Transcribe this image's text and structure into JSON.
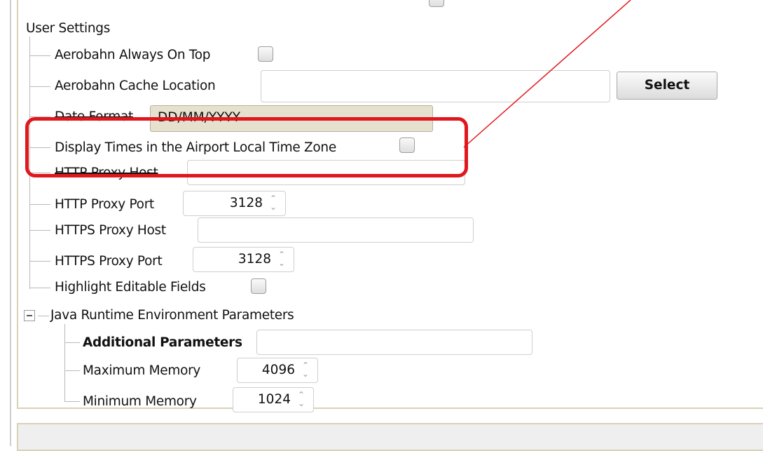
{
  "user_settings": {
    "header": "User Settings",
    "always_on_top_label": "Aerobahn Always On Top",
    "cache_location_label": "Aerobahn Cache Location",
    "cache_location_value": "",
    "select_button": "Select",
    "date_format_label": "Date Format",
    "date_format_value": "DD/MM/YYYY",
    "display_times_label": "Display Times in the Airport Local Time Zone",
    "http_proxy_host_label": "HTTP Proxy Host",
    "http_proxy_host_value": "",
    "http_proxy_port_label": "HTTP Proxy Port",
    "http_proxy_port_value": "3128",
    "https_proxy_host_label": "HTTPS Proxy Host",
    "https_proxy_host_value": "",
    "https_proxy_port_label": "HTTPS Proxy Port",
    "https_proxy_port_value": "3128",
    "highlight_editable_label": "Highlight Editable Fields"
  },
  "jre": {
    "header": "Java Runtime Environment Parameters",
    "additional_params_label": "Additional Parameters",
    "additional_params_value": "",
    "max_memory_label": "Maximum Memory",
    "max_memory_value": "4096",
    "min_memory_label": "Minimum Memory",
    "min_memory_value": "1024"
  },
  "annotation": {
    "highlight_color": "#e0171c"
  }
}
